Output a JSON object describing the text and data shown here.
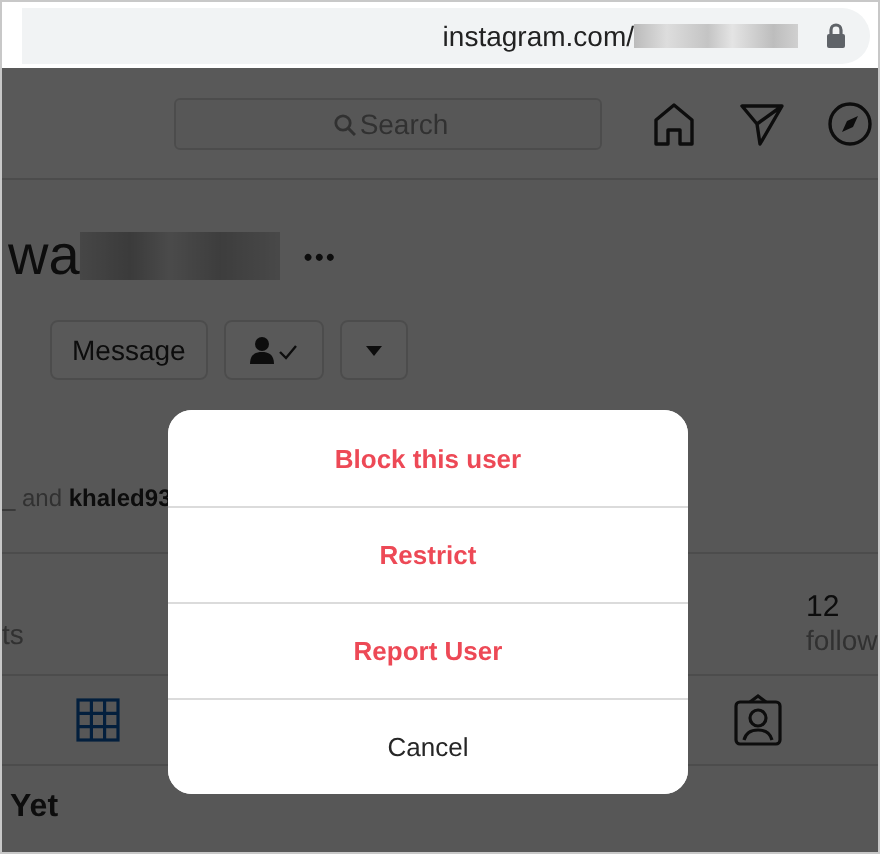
{
  "address_bar": {
    "url": "instagram.com/",
    "secure": true
  },
  "header": {
    "search": {
      "placeholder": "Search"
    }
  },
  "profile": {
    "username": "wa",
    "more": "•••",
    "buttons": [
      {
        "kind": "text",
        "label": "Message"
      },
      {
        "kind": "following"
      },
      {
        "kind": "dropdown"
      }
    ],
    "followed_by": {
      "prefix": "_ and ",
      "name": "khaled93"
    },
    "stats_left_label": "ts",
    "stats_right": {
      "value": "12",
      "label": "follow"
    }
  },
  "tabs": [
    {
      "kind": "grid",
      "selected": true
    },
    {
      "kind": "tagged",
      "selected": false
    }
  ],
  "empty_state": {
    "title": "Yet"
  },
  "menu": {
    "items": [
      {
        "kind": "danger",
        "label": "Block this user"
      },
      {
        "kind": "danger",
        "label": "Restrict"
      },
      {
        "kind": "danger",
        "label": "Report User"
      },
      {
        "kind": "normal",
        "label": "Cancel"
      }
    ]
  }
}
